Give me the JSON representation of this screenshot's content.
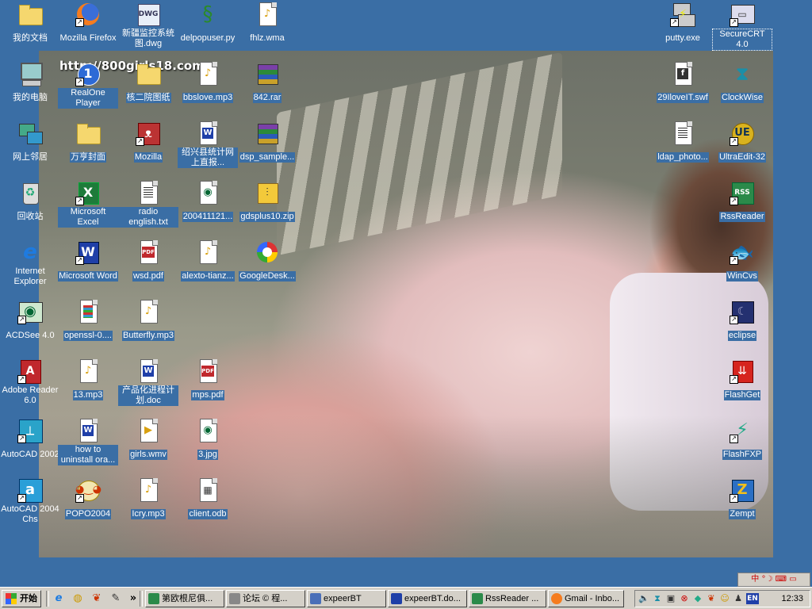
{
  "wallpaper": {
    "overlay_text": "http://800girls18.com"
  },
  "desktop_icons": {
    "my_documents": "我的文档",
    "firefox": "Mozilla Firefox",
    "xinjiang_dwg": "新疆监控系统图.dwg",
    "delpopuser": "delpopuser.py",
    "fhlz": "fhlz.wma",
    "putty": "putty.exe",
    "securecrt": "SecureCRT 4.0",
    "my_computer": "我的电脑",
    "realone": "RealOne Player",
    "hezeyuan": "核二院图纸",
    "bbslove": "bbslove.mp3",
    "rar842": "842.rar",
    "swf29": "29IloveIT.swf",
    "clockwise": "ClockWise",
    "network": "网上邻居",
    "wanheng": "万亨封面",
    "mozilla": "Mozilla",
    "shaoxing": "绍兴县统计网上直报...",
    "dsp_sample": "dsp_sample...",
    "ldap_photo": "ldap_photo...",
    "ultraedit": "UltraEdit-32",
    "recycle": "回收站",
    "excel": "Microsoft Excel",
    "radio_english": "radio english.txt",
    "img200411": "200411121...",
    "gdsplus": "gdsplus10.zip",
    "rssreader": "RssReader",
    "ie": "Internet Explorer",
    "word": "Microsoft Word",
    "wsd_pdf": "wsd.pdf",
    "alexto": "alexto-tianz...",
    "googledesk": "GoogleDesk...",
    "wincvs": "WinCvs",
    "acdsee": "ACDSee 4.0",
    "openssl": "openssl-0....",
    "butterfly": "Butterfly.mp3",
    "eclipse": "eclipse",
    "adobe_reader": "Adobe Reader 6.0",
    "mp3_13": "13.mp3",
    "chanpinhua": "产品化进程计划.doc",
    "mps_pdf": "mps.pdf",
    "flashget": "FlashGet",
    "autocad2002": "AutoCAD 2002",
    "howto": "how to uninstall ora...",
    "girls_wmv": "girls.wmv",
    "jpg3": "3.jpg",
    "flashfxp": "FlashFXP",
    "autocad2004": "AutoCAD 2004 Chs",
    "popo": "POPO2004",
    "icry": "Icry.mp3",
    "client_odb": "client.odb",
    "zempt": "Zempt"
  },
  "taskbar": {
    "start_label": "开始",
    "chevron": "»",
    "buttons": [
      "第欧根尼俱...",
      "论坛 © 程...",
      "expeerBT",
      "expeerBT.do...",
      "RssReader ...",
      "Gmail - Inbo..."
    ],
    "tray_lang": "EN",
    "clock": "12:33"
  },
  "colors": {
    "desktop": "#3a6ea5",
    "taskbar": "#d4d0c8"
  }
}
